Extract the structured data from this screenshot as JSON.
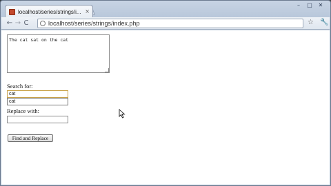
{
  "browser": {
    "tab_title": "localhost/series/strings/i...",
    "tab_close": "×",
    "window_controls": [
      "–",
      "□",
      "✕"
    ],
    "nav": {
      "back": "←",
      "forward": "→",
      "reload": "C"
    },
    "url": "localhost/series/strings/index.php",
    "bookmark_icon": "star-icon",
    "menu_icon": "wrench-icon",
    "star": "☆",
    "wrench": "🔧"
  },
  "page": {
    "textarea_value": "The cat sat on the cat",
    "search_label": "Search for:",
    "search_value": "cat",
    "autocomplete_suggestion": "cat",
    "replace_label": "Replace with:",
    "replace_value": "",
    "submit_label": "Find and Replace"
  }
}
